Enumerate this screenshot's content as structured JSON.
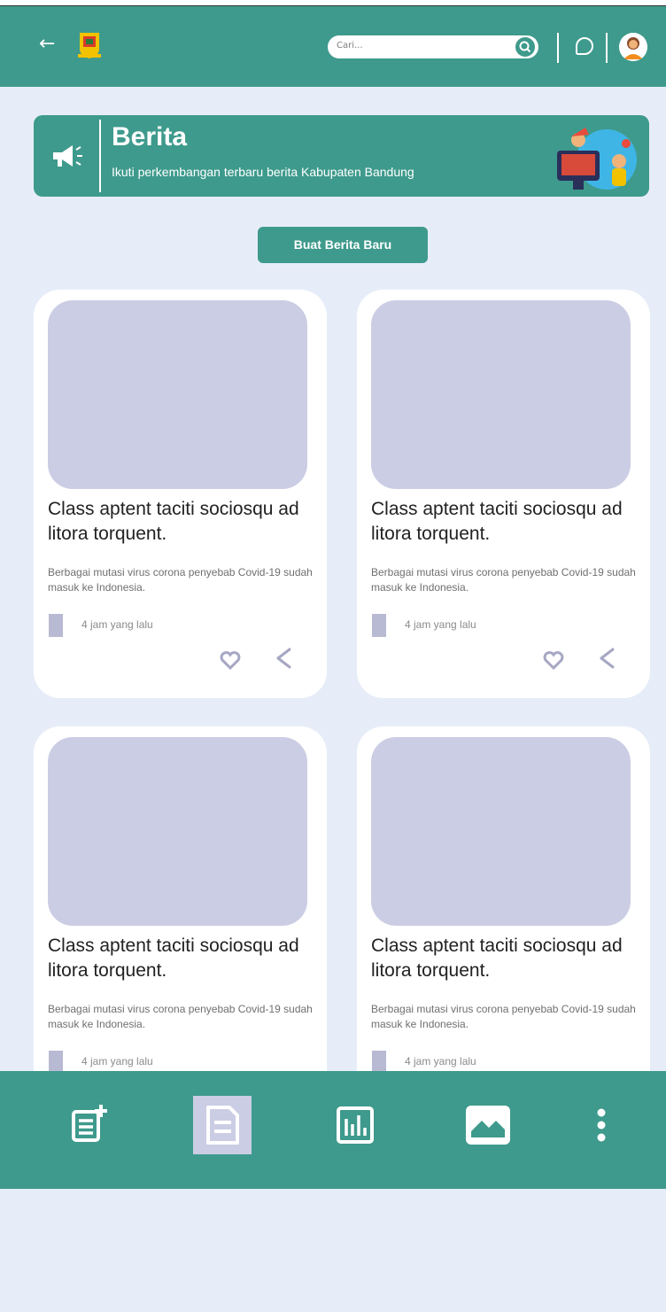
{
  "header": {
    "search_placeholder": "Cari..."
  },
  "banner": {
    "title": "Berita",
    "subtitle": "Ikuti perkembangan terbaru berita Kabupaten Bandung"
  },
  "actions": {
    "create_news_label": "Buat Berita Baru"
  },
  "news_cards": [
    {
      "title": "Class aptent taciti sociosqu ad litora torquent.",
      "description": "Berbagai mutasi virus corona penyebab Covid-19 sudah masuk ke Indonesia.",
      "time": "4 jam yang lalu"
    },
    {
      "title": "Class aptent taciti sociosqu ad litora torquent.",
      "description": "Berbagai mutasi virus corona penyebab Covid-19 sudah masuk ke Indonesia.",
      "time": "4 jam yang lalu"
    },
    {
      "title": "Class aptent taciti sociosqu ad litora torquent.",
      "description": "Berbagai mutasi virus corona penyebab Covid-19 sudah masuk ke Indonesia.",
      "time": "4 jam yang lalu"
    },
    {
      "title": "Class aptent taciti sociosqu ad litora torquent.",
      "description": "Berbagai mutasi virus corona penyebab Covid-19 sudah masuk ke Indonesia.",
      "time": "4 jam yang lalu"
    }
  ],
  "bottom_nav": {
    "active_index": 1,
    "items": [
      "add-news-icon",
      "news-list-icon",
      "chart-icon",
      "image-icon",
      "more-icon"
    ]
  },
  "colors": {
    "brand": "#3e9a8c",
    "background": "#e7edf8",
    "placeholder": "#cbcde4"
  }
}
